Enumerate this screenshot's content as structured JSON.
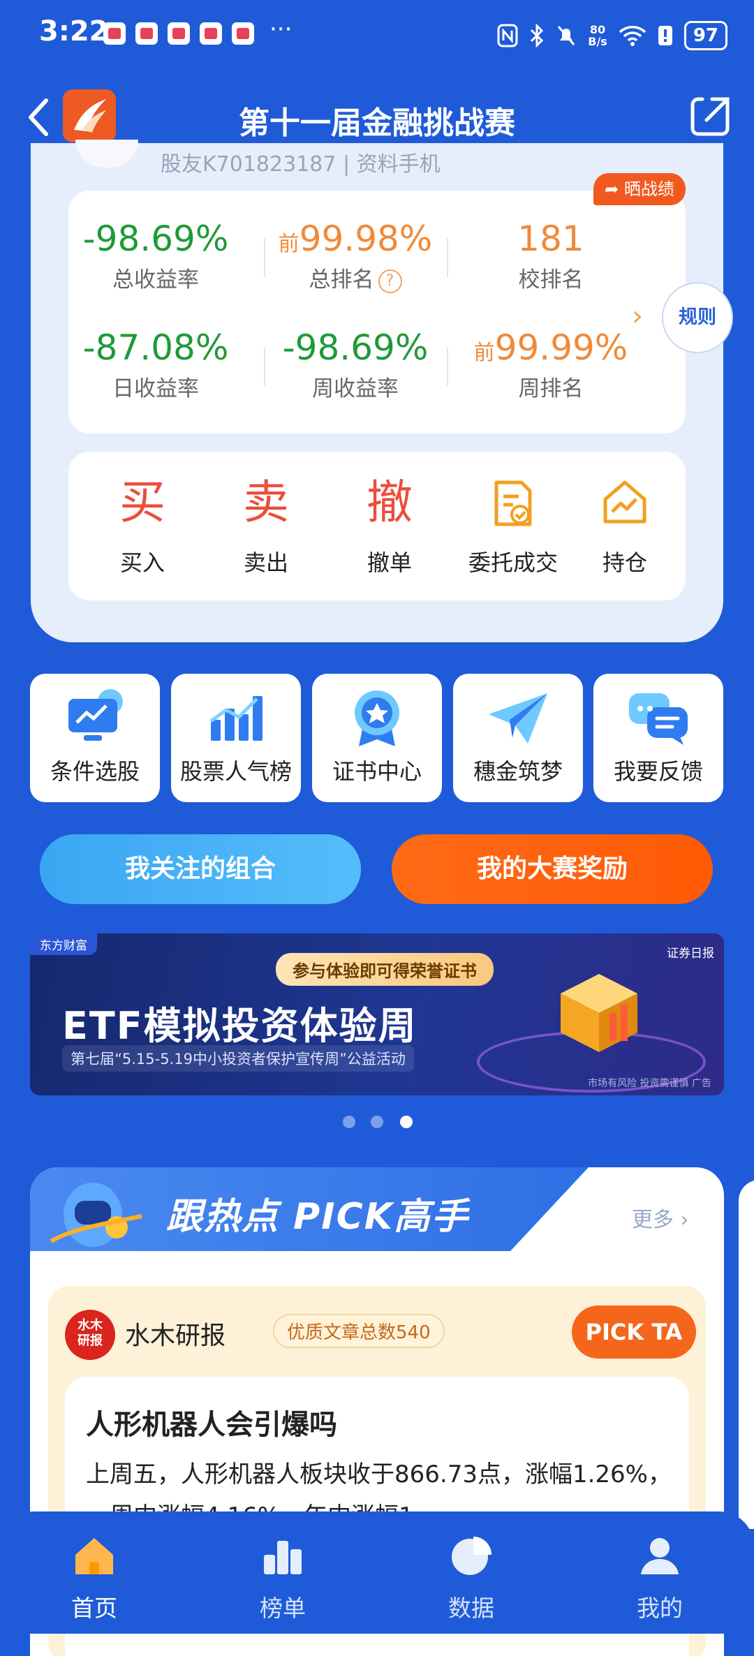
{
  "status_bar": {
    "time": "3:22",
    "more": "···",
    "net_speed_value": "80",
    "net_speed_unit": "B/s",
    "battery": "97"
  },
  "header": {
    "title": "第十一届金融挑战赛"
  },
  "profile": {
    "partial_text": "股友K701823187 | 资料手机"
  },
  "share_badge": "晒战绩",
  "stats": {
    "total_return": {
      "value": "-98.69%",
      "label": "总收益率"
    },
    "total_rank": {
      "prefix": "前",
      "value": "99.98%",
      "label": "总排名",
      "help": "?"
    },
    "school_rank": {
      "value": "181",
      "label": "校排名"
    },
    "daily_return": {
      "value": "-87.08%",
      "label": "日收益率"
    },
    "weekly_return": {
      "value": "-98.69%",
      "label": "周收益率"
    },
    "weekly_rank": {
      "prefix": "前",
      "value": "99.99%",
      "label": "周排名"
    }
  },
  "rules_label": "规则",
  "actions": [
    {
      "glyph": "买",
      "label": "买入"
    },
    {
      "glyph": "卖",
      "label": "卖出"
    },
    {
      "glyph": "撤",
      "label": "撤单"
    },
    {
      "icon": "entrust-icon",
      "label": "委托成交"
    },
    {
      "icon": "position-icon",
      "label": "持仓"
    }
  ],
  "tools": [
    {
      "label": "条件选股",
      "icon": "monitor-chart-icon"
    },
    {
      "label": "股票人气榜",
      "icon": "bar-chart-icon"
    },
    {
      "label": "证书中心",
      "icon": "medal-icon"
    },
    {
      "label": "穗金筑梦",
      "icon": "paper-plane-icon"
    },
    {
      "label": "我要反馈",
      "icon": "chat-bubble-icon"
    }
  ],
  "buttons": {
    "follow": "我关注的组合",
    "reward": "我的大赛奖励"
  },
  "banner": {
    "brand": "东方财富",
    "brand2": "证券日报",
    "pill": "参与体验即可得荣誉证书",
    "headline": "ETF模拟投资体验周",
    "subline": "第七届“5.15-5.19中小投资者保护宣传周”公益活动",
    "note": "市场有风险 投资需谨慎 广告"
  },
  "carousel": {
    "count": 3,
    "active": 3
  },
  "pick_section": {
    "title": "跟热点 PICK高手",
    "more": "更多",
    "author": {
      "avatar_text_1": "水木",
      "avatar_text_2": "研报",
      "name": "水木研报",
      "badge": "优质文章总数540",
      "button": "PICK TA"
    },
    "article": {
      "title": "人形机器人会引爆吗",
      "body": "上周五，人形机器人板块收于866.73点，涨幅1.26%，一周内涨幅4.16%，年内涨幅1..."
    }
  },
  "bottom_nav": [
    {
      "label": "首页",
      "icon": "home-icon",
      "active": true
    },
    {
      "label": "榜单",
      "icon": "leaderboard-icon",
      "active": false
    },
    {
      "label": "数据",
      "icon": "pie-chart-icon",
      "active": false
    },
    {
      "label": "我的",
      "icon": "user-icon",
      "active": false
    }
  ],
  "colors": {
    "brand_blue": "#1f5bd8",
    "negative_green": "#1f9a37",
    "rank_orange": "#ef8a3a",
    "action_red": "#ea4e3b",
    "accent_orange": "#f4661c"
  }
}
